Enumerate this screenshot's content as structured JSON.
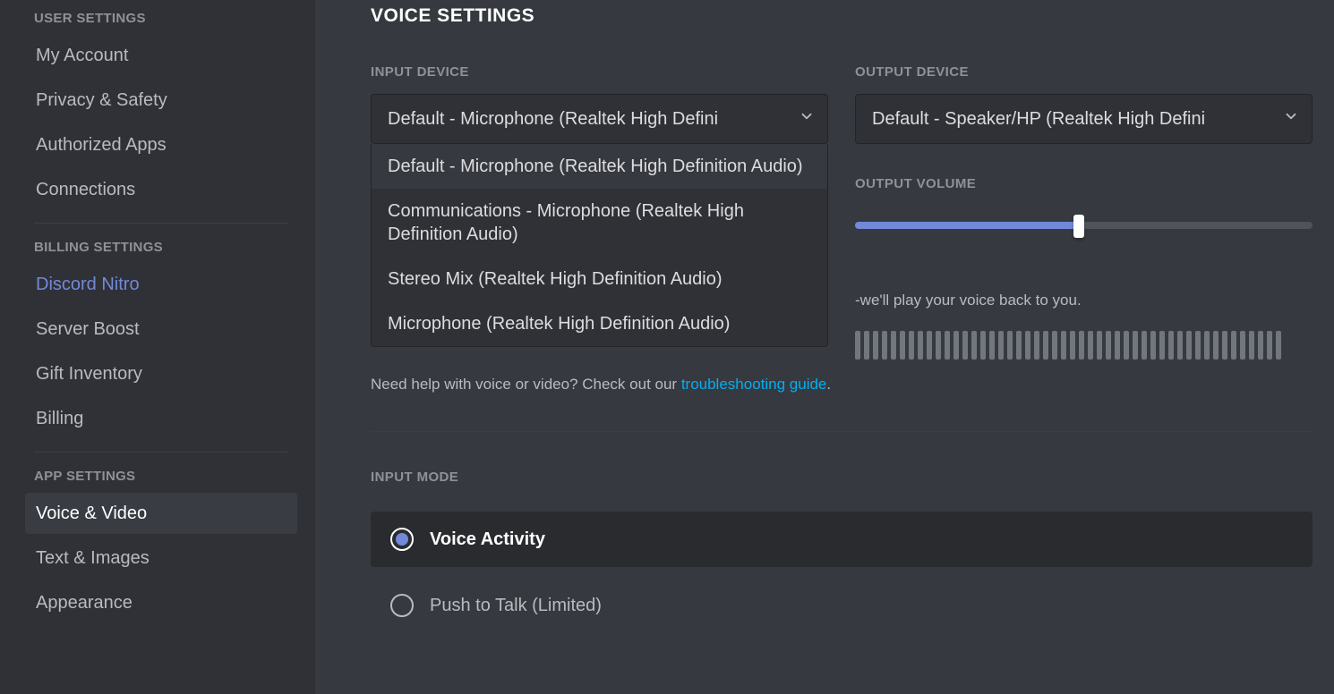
{
  "sidebar": {
    "sections": [
      {
        "header": "USER SETTINGS",
        "items": [
          {
            "label": "My Account"
          },
          {
            "label": "Privacy & Safety"
          },
          {
            "label": "Authorized Apps"
          },
          {
            "label": "Connections"
          }
        ]
      },
      {
        "header": "BILLING SETTINGS",
        "items": [
          {
            "label": "Discord Nitro",
            "variant": "nitro"
          },
          {
            "label": "Server Boost"
          },
          {
            "label": "Gift Inventory"
          },
          {
            "label": "Billing"
          }
        ]
      },
      {
        "header": "APP SETTINGS",
        "items": [
          {
            "label": "Voice & Video",
            "selected": true
          },
          {
            "label": "Text & Images"
          },
          {
            "label": "Appearance"
          }
        ]
      }
    ]
  },
  "main": {
    "title": "VOICE SETTINGS",
    "input_device": {
      "label": "INPUT DEVICE",
      "selected": "Default - Microphone (Realtek High Defini",
      "options": [
        "Default - Microphone (Realtek High Definition Audio)",
        "Communications - Microphone (Realtek High Definition Audio)",
        "Stereo Mix (Realtek High Definition Audio)",
        "Microphone (Realtek High Definition Audio)"
      ]
    },
    "output_device": {
      "label": "OUTPUT DEVICE",
      "selected": "Default - Speaker/HP (Realtek High Defini"
    },
    "output_volume": {
      "label": "OUTPUT VOLUME",
      "percent": 49
    },
    "mic_test_trail": "-we'll play your voice back to you.",
    "help": {
      "prefix": "Need help with voice or video? Check out our ",
      "link_text": "troubleshooting guide",
      "suffix": "."
    },
    "input_mode": {
      "label": "INPUT MODE",
      "options": [
        {
          "label": "Voice Activity",
          "selected": true
        },
        {
          "label": "Push to Talk (Limited)",
          "selected": false
        }
      ]
    }
  }
}
